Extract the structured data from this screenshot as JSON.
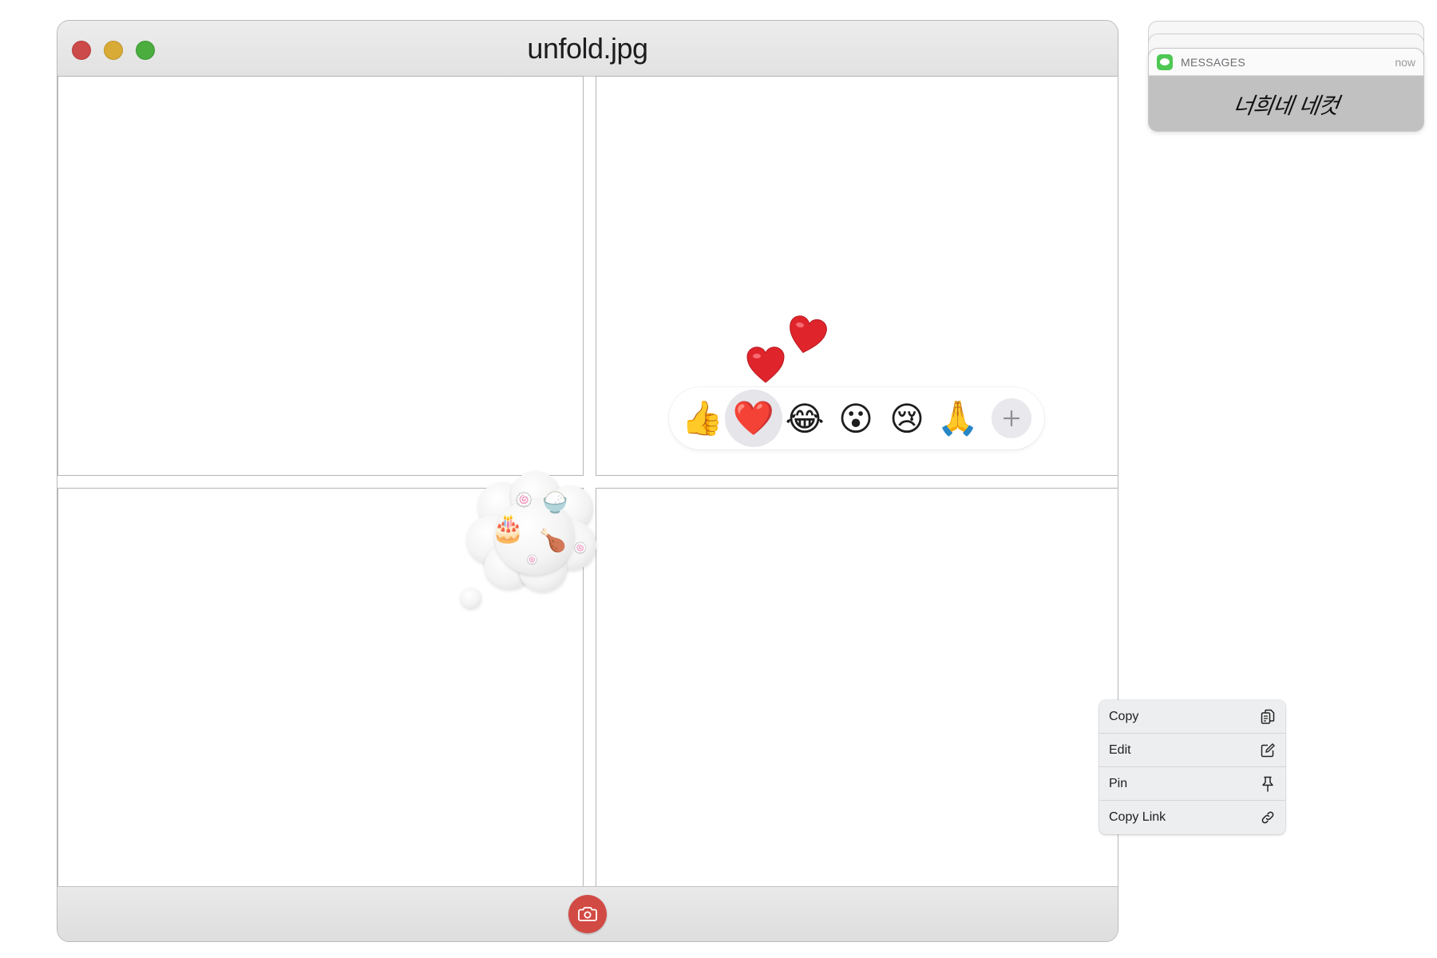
{
  "window": {
    "title": "unfold.jpg"
  },
  "tapback": {
    "reactions": [
      {
        "name": "thumbs-up",
        "glyph": "👍"
      },
      {
        "name": "heart",
        "glyph": "❤️",
        "selected": true
      },
      {
        "name": "laughing",
        "glyph": "😂"
      },
      {
        "name": "surprised",
        "glyph": "😮"
      },
      {
        "name": "crying",
        "glyph": "😢"
      },
      {
        "name": "praying-hands",
        "glyph": "🙏"
      }
    ],
    "more_icon": "plus-icon"
  },
  "thought_bubble": {
    "glyphs": {
      "cake": "🎂",
      "chicken": "🍗",
      "rice": "🍚",
      "fishcake": "🍥"
    }
  },
  "notification": {
    "app": "MESSAGES",
    "time": "now",
    "body": "너희네 네컷"
  },
  "context_menu": {
    "items": [
      {
        "label": "Copy",
        "icon": "copy-icon"
      },
      {
        "label": "Edit",
        "icon": "edit-icon"
      },
      {
        "label": "Pin",
        "icon": "pin-icon"
      },
      {
        "label": "Copy Link",
        "icon": "link-icon"
      }
    ]
  },
  "colors": {
    "close": "#cd4a4a",
    "minimize": "#d8ab36",
    "maximize": "#4aad3e",
    "camera_button": "#d24a44",
    "messages_green": "#4ec753"
  }
}
